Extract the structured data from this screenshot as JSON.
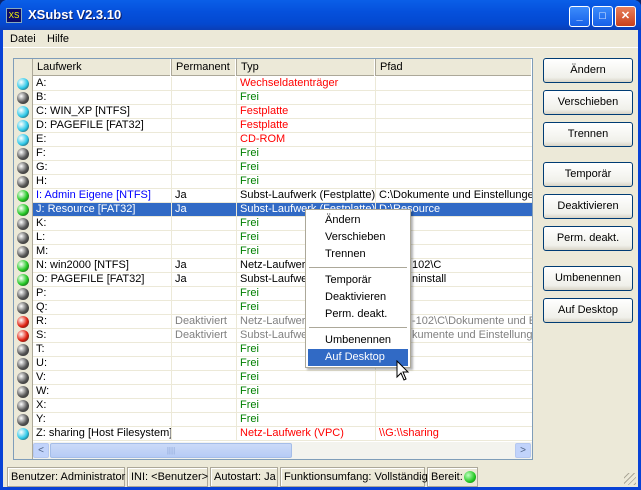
{
  "window": {
    "title": "XSubst V2.3.10",
    "icon_text": "XS"
  },
  "menu": [
    "Datei",
    "Hilfe"
  ],
  "columns": [
    "Laufwerk",
    "Permanent",
    "Typ",
    "Pfad"
  ],
  "rows": [
    {
      "led": "#2ec8e8",
      "drive": "A:",
      "perm": "",
      "type": "Wechseldatenträger",
      "path": "",
      "style": "red"
    },
    {
      "led": "#555",
      "drive": "B:",
      "perm": "",
      "type": "Frei",
      "path": "",
      "style": "free"
    },
    {
      "led": "#2ec8e8",
      "drive": "C:  WIN_XP [NTFS]",
      "perm": "",
      "type": "Festplatte",
      "path": "",
      "style": "red"
    },
    {
      "led": "#2ec8e8",
      "drive": "D:  PAGEFILE [FAT32]",
      "perm": "",
      "type": "Festplatte",
      "path": "",
      "style": "red"
    },
    {
      "led": "#2ec8e8",
      "drive": "E:",
      "perm": "",
      "type": "CD-ROM",
      "path": "",
      "style": "red"
    },
    {
      "led": "#555",
      "drive": "F:",
      "perm": "",
      "type": "Frei",
      "path": "",
      "style": "free"
    },
    {
      "led": "#555",
      "drive": "G:",
      "perm": "",
      "type": "Frei",
      "path": "",
      "style": "free"
    },
    {
      "led": "#555",
      "drive": "H:",
      "perm": "",
      "type": "Frei",
      "path": "",
      "style": "free"
    },
    {
      "led": "#22c822",
      "drive": "I:  Admin Eigene [NTFS]",
      "perm": "Ja",
      "type": "Subst-Laufwerk (Festplatte)",
      "path": "C:\\Dokumente und Einstellungen",
      "style": "blue"
    },
    {
      "led": "#22c822",
      "drive": "J:  Resource [FAT32]",
      "perm": "Ja",
      "type": "Subst-Laufwerk (Festplatte)",
      "path": "D:\\Resource",
      "style": "sel"
    },
    {
      "led": "#555",
      "drive": "K:",
      "perm": "",
      "type": "Frei",
      "path": "",
      "style": "free"
    },
    {
      "led": "#555",
      "drive": "L:",
      "perm": "",
      "type": "Frei",
      "path": "",
      "style": "free"
    },
    {
      "led": "#555",
      "drive": "M:",
      "perm": "",
      "type": "Frei",
      "path": "",
      "style": "free"
    },
    {
      "led": "#22c822",
      "drive": "N:  win2000 [NTFS]",
      "perm": "Ja",
      "type": "Netz-Laufwerk",
      "path": "102\\C",
      "style": "normal",
      "partial": true
    },
    {
      "led": "#22c822",
      "drive": "O:  PAGEFILE [FAT32]",
      "perm": "Ja",
      "type": "Subst-Laufwerk",
      "path": "ninstall",
      "style": "normal",
      "partial": true
    },
    {
      "led": "#555",
      "drive": "P:",
      "perm": "",
      "type": "Frei",
      "path": "",
      "style": "free"
    },
    {
      "led": "#555",
      "drive": "Q:",
      "perm": "",
      "type": "Frei",
      "path": "",
      "style": "free"
    },
    {
      "led": "#e02010",
      "drive": "R:",
      "perm": "Deaktiviert",
      "type": "Netz-Laufwerk",
      "path": "-102\\C\\Dokumente und E",
      "style": "grey",
      "partial": true
    },
    {
      "led": "#e02010",
      "drive": "S:",
      "perm": "Deaktiviert",
      "type": "Subst-Laufwerk",
      "path": "kumente und Einstellunge",
      "style": "grey",
      "partial": true
    },
    {
      "led": "#555",
      "drive": "T:",
      "perm": "",
      "type": "Frei",
      "path": "",
      "style": "free"
    },
    {
      "led": "#555",
      "drive": "U:",
      "perm": "",
      "type": "Frei",
      "path": "",
      "style": "free"
    },
    {
      "led": "#555",
      "drive": "V:",
      "perm": "",
      "type": "Frei",
      "path": "",
      "style": "free"
    },
    {
      "led": "#555",
      "drive": "W:",
      "perm": "",
      "type": "Frei",
      "path": "",
      "style": "free"
    },
    {
      "led": "#555",
      "drive": "X:",
      "perm": "",
      "type": "Frei",
      "path": "",
      "style": "free"
    },
    {
      "led": "#555",
      "drive": "Y:",
      "perm": "",
      "type": "Frei",
      "path": "",
      "style": "free"
    },
    {
      "led": "#2ec8e8",
      "drive": "Z:  sharing [Host Filesystem]",
      "perm": "",
      "type": "Netz-Laufwerk (VPC)",
      "path": "\\\\G:\\\\sharing",
      "style": "red"
    }
  ],
  "buttons": [
    "Ändern",
    "Verschieben",
    "Trennen",
    "Temporär",
    "Deaktivieren",
    "Perm. deakt.",
    "Umbenennen",
    "Auf Desktop"
  ],
  "context_menu": [
    "Ändern",
    "Verschieben",
    "Trennen",
    "Temporär",
    "Deaktivieren",
    "Perm. deakt.",
    "Umbenennen",
    "Auf Desktop"
  ],
  "status": {
    "user": "Benutzer: Administrator",
    "ini": "INI: <Benutzer>",
    "autostart": "Autostart: Ja",
    "scope": "Funktionsumfang: Vollständig",
    "ready": "Bereit:"
  },
  "colors": {
    "free": "#008000",
    "red": "#ff0000",
    "blue": "#0000ff",
    "grey": "#808080",
    "selection": "#316ac5"
  }
}
